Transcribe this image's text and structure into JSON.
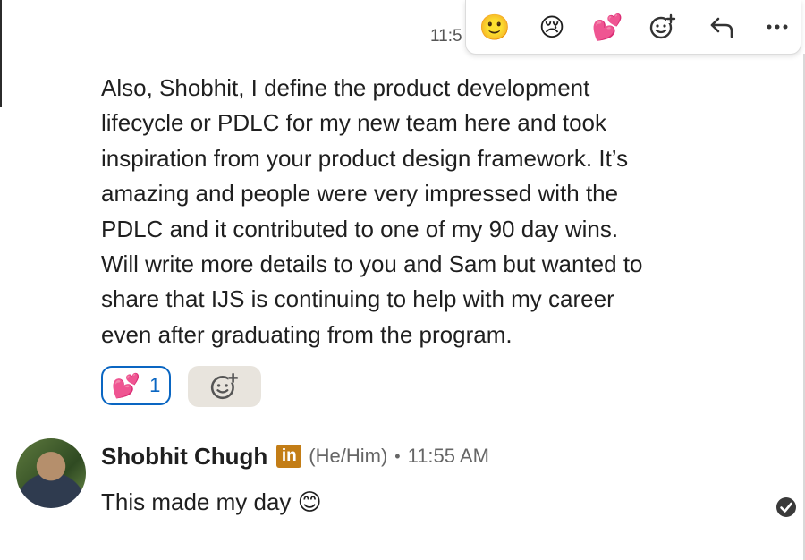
{
  "timestamp_top": "11:5",
  "reaction_bar": {
    "emojis": [
      "🙂",
      "😢",
      "💕"
    ],
    "add_reaction": "add-reaction",
    "reply": "reply",
    "more": "more"
  },
  "message": {
    "lines": [
      "Also, Shobhit, I define the product development",
      "lifecycle or PDLC for my new team here and took",
      "inspiration from your product design framework. It’s",
      "amazing and people were very impressed with the",
      "PDLC and it contributed to one of my 90 day wins.",
      "Will write more details to you and Sam but wanted to",
      "share that IJS is continuing to help with my career",
      "even after graduating from the program."
    ],
    "reaction": {
      "emoji": "💕",
      "count": "1"
    }
  },
  "reply": {
    "sender_name": "Shobhit Chugh",
    "badge_text": "in",
    "pronouns": "(He/Him)",
    "separator": "•",
    "time": "11:55 AM",
    "text": "This made my day 😊"
  },
  "colors": {
    "linkedin_blue": "#0a66c2",
    "badge_gold": "#c37d16",
    "chip_gray": "#e8e4dd"
  }
}
